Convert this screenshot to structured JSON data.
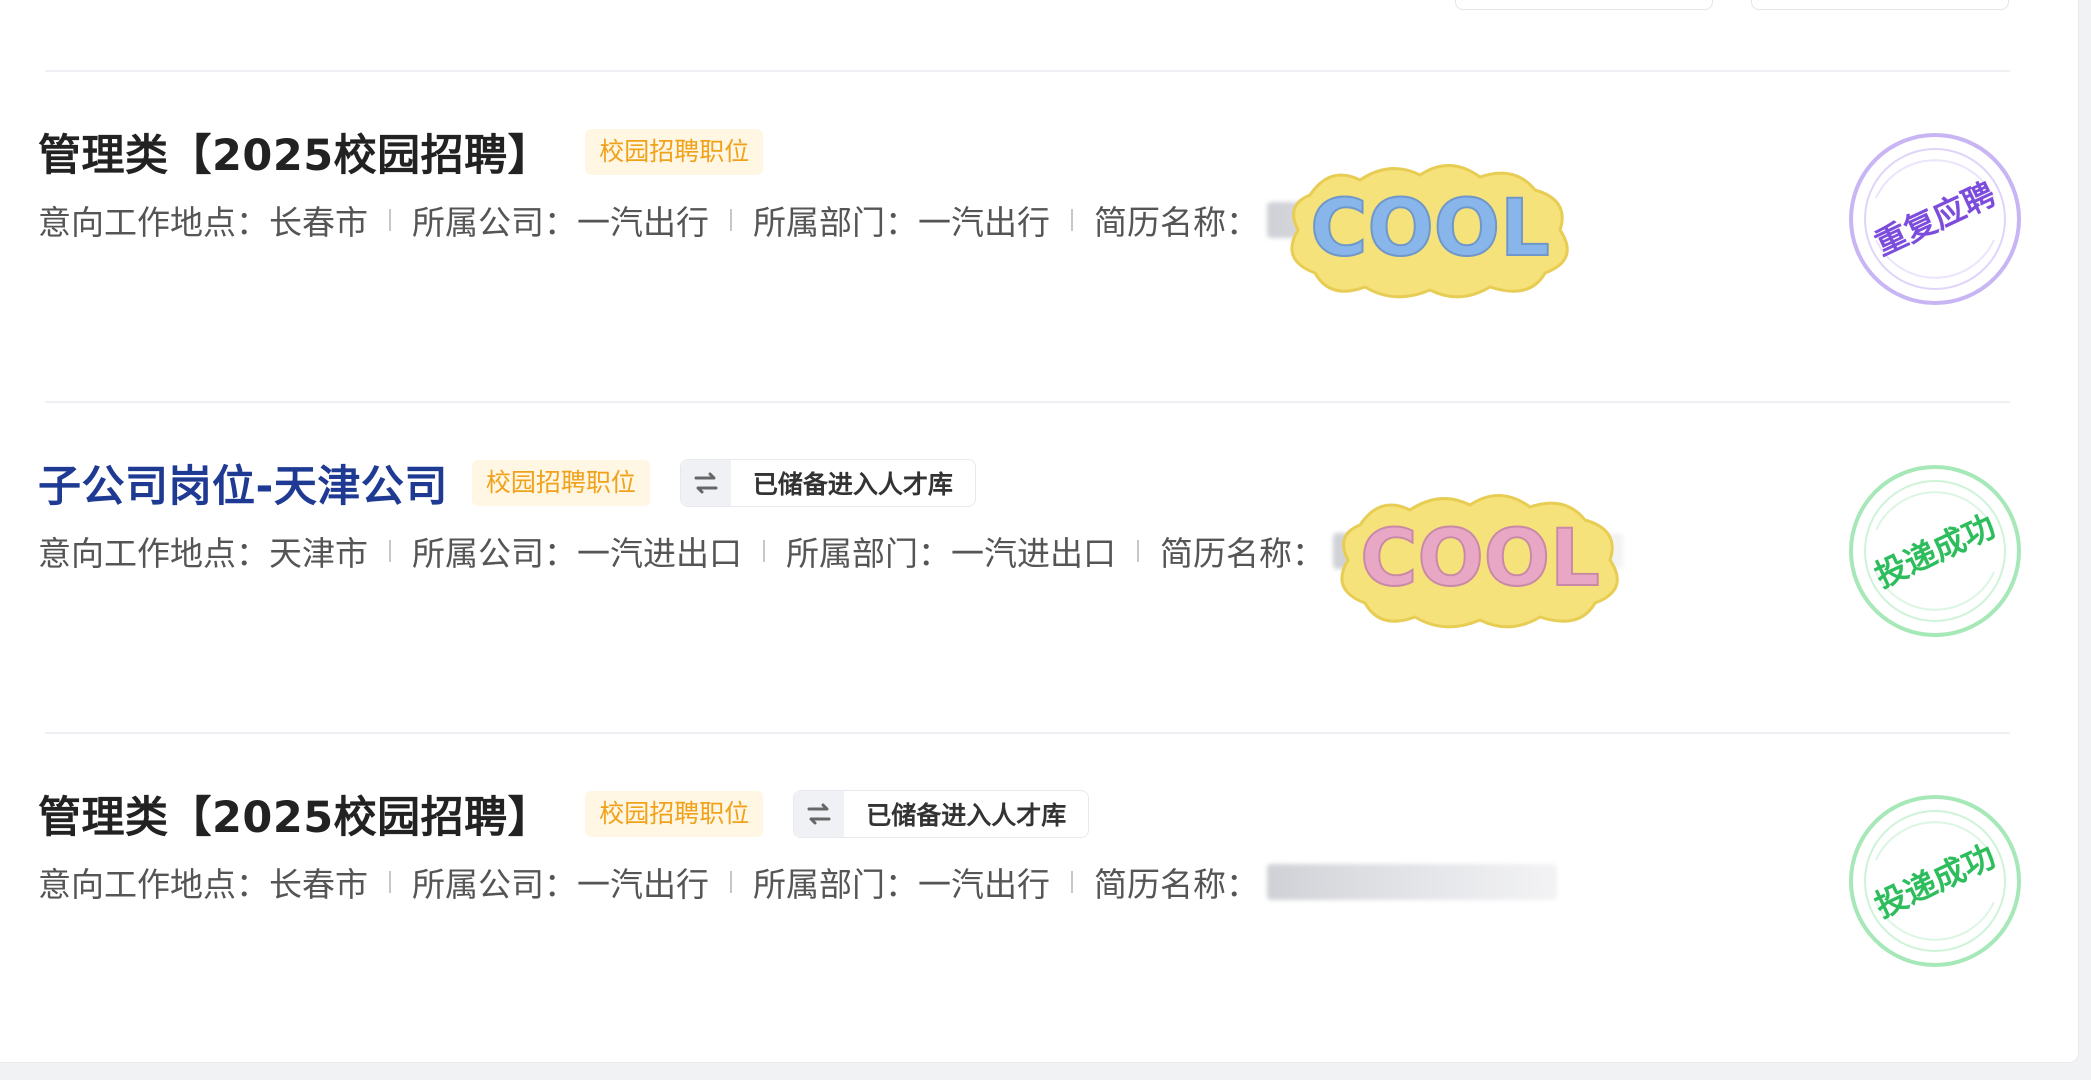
{
  "jobs": [
    {
      "title": "管理类【2025校园招聘】",
      "tags": {
        "campus": "校园招聘职位"
      },
      "meta": {
        "location_label": "意向工作地点：",
        "location": "长春市",
        "company_label": "所属公司：",
        "company": "一汽出行",
        "dept_label": "所属部门：",
        "dept": "一汽出行",
        "resume_label": "简历名称："
      },
      "stamp": {
        "text": "重复应聘",
        "color": "#8b5cf6"
      }
    },
    {
      "title": "子公司岗位-天津公司",
      "tags": {
        "campus": "校园招聘职位",
        "talent": "已储备进入人才库"
      },
      "meta": {
        "location_label": "意向工作地点：",
        "location": "天津市",
        "company_label": "所属公司：",
        "company": "一汽进出口",
        "dept_label": "所属部门：",
        "dept": "一汽进出口",
        "resume_label": "简历名称："
      },
      "stamp": {
        "text": "投递成功",
        "color": "#22c55e"
      }
    },
    {
      "title": "管理类【2025校园招聘】",
      "tags": {
        "campus": "校园招聘职位",
        "talent": "已储备进入人才库"
      },
      "meta": {
        "location_label": "意向工作地点：",
        "location": "长春市",
        "company_label": "所属公司：",
        "company": "一汽出行",
        "dept_label": "所属部门：",
        "dept": "一汽出行",
        "resume_label": "简历名称："
      },
      "stamp": {
        "text": "投递成功",
        "color": "#22c55e"
      }
    }
  ],
  "sticker": {
    "text": "COOL"
  },
  "icons": {
    "talent": "swap-icon"
  }
}
